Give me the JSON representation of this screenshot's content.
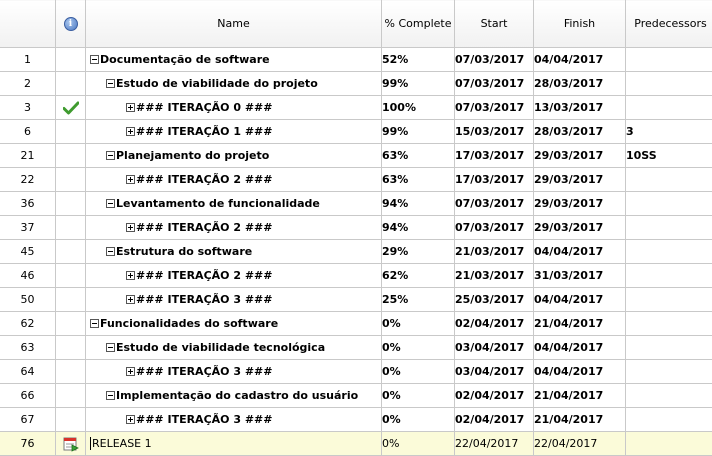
{
  "columns": {
    "id": "",
    "info_icon": "info-icon",
    "name": "Name",
    "complete": "% Complete",
    "start": "Start",
    "finish": "Finish",
    "predecessors": "Predecessors"
  },
  "rows": [
    {
      "id": "1",
      "level": 0,
      "toggle": "minus",
      "name": "Documentação de software",
      "complete": "52%",
      "start": "07/03/2017",
      "finish": "04/04/2017",
      "pred": ""
    },
    {
      "id": "2",
      "level": 1,
      "toggle": "minus",
      "name": "Estudo de viabilidade do projeto",
      "complete": "99%",
      "start": "07/03/2017",
      "finish": "28/03/2017",
      "pred": ""
    },
    {
      "id": "3",
      "level": 2,
      "toggle": "plus",
      "name": "### ITERAÇÃO 0 ###",
      "complete": "100%",
      "start": "07/03/2017",
      "finish": "13/03/2017",
      "pred": "",
      "icon": "check-icon"
    },
    {
      "id": "6",
      "level": 2,
      "toggle": "plus",
      "name": "### ITERAÇÃO 1 ###",
      "complete": "99%",
      "start": "15/03/2017",
      "finish": "28/03/2017",
      "pred": "3"
    },
    {
      "id": "21",
      "level": 1,
      "toggle": "minus",
      "name": "Planejamento do projeto",
      "complete": "63%",
      "start": "17/03/2017",
      "finish": "29/03/2017",
      "pred": "10SS"
    },
    {
      "id": "22",
      "level": 2,
      "toggle": "plus",
      "name": "### ITERAÇÃO 2 ###",
      "complete": "63%",
      "start": "17/03/2017",
      "finish": "29/03/2017",
      "pred": ""
    },
    {
      "id": "36",
      "level": 1,
      "toggle": "minus",
      "name": "Levantamento de funcionalidade",
      "complete": "94%",
      "start": "07/03/2017",
      "finish": "29/03/2017",
      "pred": ""
    },
    {
      "id": "37",
      "level": 2,
      "toggle": "plus",
      "name": "### ITERAÇÃO 2 ###",
      "complete": "94%",
      "start": "07/03/2017",
      "finish": "29/03/2017",
      "pred": ""
    },
    {
      "id": "45",
      "level": 1,
      "toggle": "minus",
      "name": "Estrutura do software",
      "complete": "29%",
      "start": "21/03/2017",
      "finish": "04/04/2017",
      "pred": ""
    },
    {
      "id": "46",
      "level": 2,
      "toggle": "plus",
      "name": "### ITERAÇÃO 2 ###",
      "complete": "62%",
      "start": "21/03/2017",
      "finish": "31/03/2017",
      "pred": ""
    },
    {
      "id": "50",
      "level": 2,
      "toggle": "plus",
      "name": "### ITERAÇÃO 3 ###",
      "complete": "25%",
      "start": "25/03/2017",
      "finish": "04/04/2017",
      "pred": ""
    },
    {
      "id": "62",
      "level": 0,
      "toggle": "minus",
      "name": "Funcionalidades do software",
      "complete": "0%",
      "start": "02/04/2017",
      "finish": "21/04/2017",
      "pred": ""
    },
    {
      "id": "63",
      "level": 1,
      "toggle": "minus",
      "name": "Estudo de viabilidade tecnológica",
      "complete": "0%",
      "start": "03/04/2017",
      "finish": "04/04/2017",
      "pred": ""
    },
    {
      "id": "64",
      "level": 2,
      "toggle": "plus",
      "name": "### ITERAÇÃO 3 ###",
      "complete": "0%",
      "start": "03/04/2017",
      "finish": "04/04/2017",
      "pred": ""
    },
    {
      "id": "66",
      "level": 1,
      "toggle": "minus",
      "name": "Implementação do cadastro do usuário",
      "complete": "0%",
      "start": "02/04/2017",
      "finish": "21/04/2017",
      "pred": ""
    },
    {
      "id": "67",
      "level": 2,
      "toggle": "plus",
      "name": "### ITERAÇÃO 3 ###",
      "complete": "0%",
      "start": "02/04/2017",
      "finish": "21/04/2017",
      "pred": ""
    },
    {
      "id": "76",
      "level": 0,
      "toggle": "",
      "name": "RELEASE 1",
      "complete": "0%",
      "start": "22/04/2017",
      "finish": "22/04/2017",
      "pred": "",
      "icon": "milestone-calendar-icon",
      "selected": true
    }
  ]
}
